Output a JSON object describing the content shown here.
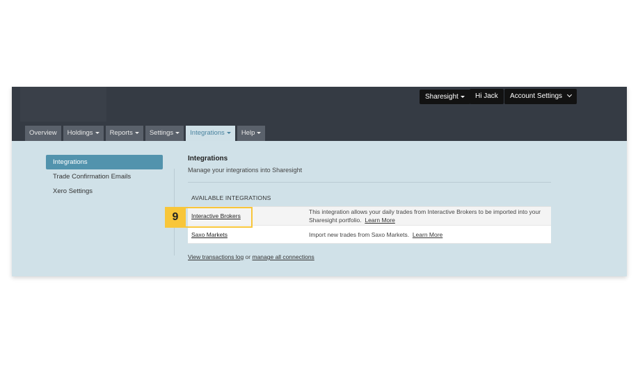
{
  "header": {
    "sharesight_menu": "Sharesight",
    "greeting": "Hi Jack",
    "account_settings": "Account Settings"
  },
  "tabs": [
    {
      "label": "Overview",
      "dropdown": false
    },
    {
      "label": "Holdings",
      "dropdown": true
    },
    {
      "label": "Reports",
      "dropdown": true
    },
    {
      "label": "Settings",
      "dropdown": true
    },
    {
      "label": "Integrations",
      "dropdown": true,
      "active": true
    },
    {
      "label": "Help",
      "dropdown": true
    }
  ],
  "sidebar": {
    "items": [
      {
        "label": "Integrations",
        "active": true
      },
      {
        "label": "Trade Confirmation Emails"
      },
      {
        "label": "Xero Settings"
      }
    ]
  },
  "main": {
    "title": "Integrations",
    "subtitle": "Manage your integrations into Sharesight",
    "section_label": "AVAILABLE INTEGRATIONS",
    "integrations": [
      {
        "name": "Interactive Brokers",
        "description": "This integration allows your daily trades from Interactive Brokers to be imported into your Sharesight portfolio.",
        "learn_more": "Learn More"
      },
      {
        "name": "Saxo Markets",
        "description": "Import new trades from Saxo Markets.",
        "learn_more": "Learn More"
      }
    ],
    "footer": {
      "transactions_log": "View transactions log",
      "or": "or",
      "manage_connections": "manage all connections"
    }
  },
  "callout": {
    "step_number": "9",
    "color": "#f8c63a"
  },
  "colors": {
    "header_bg": "#353b44",
    "content_bg": "#d0e1e8",
    "sidebar_active": "#5293ad",
    "tab_active_text": "#4b84a0"
  }
}
